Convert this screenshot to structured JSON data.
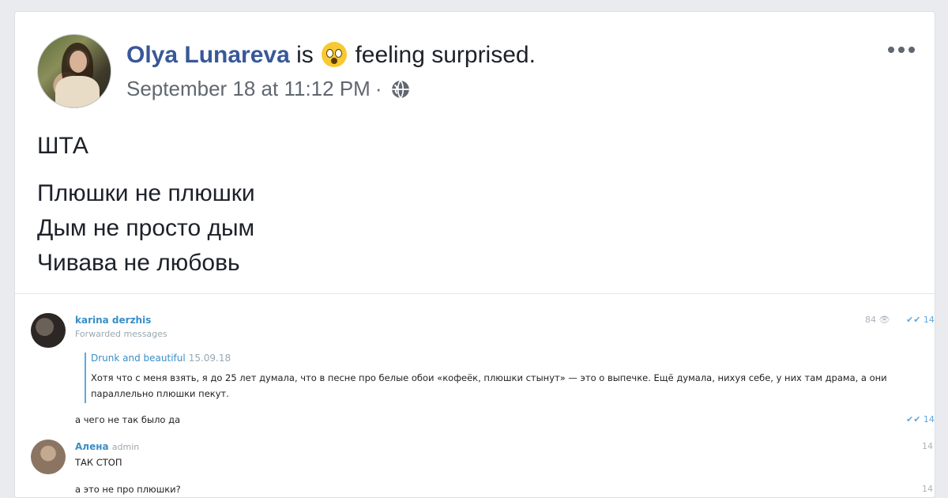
{
  "post": {
    "author": "Olya Lunareva",
    "is_text": "is",
    "feeling_text": "feeling surprised.",
    "timestamp": "September 18 at 11:12 PM",
    "separator": "·",
    "text_line_1": "ШТА",
    "text_line_2": "Плюшки не плюшки",
    "text_line_3": "Дым не просто дым",
    "text_line_4": "Чивава не любовь"
  },
  "chat": {
    "msg1": {
      "sender": "karina derzhis",
      "forwarded_label": "Forwarded messages",
      "views": "84 👁",
      "ticks": "✔✔ 14",
      "fwd_name": "Drunk and beautiful",
      "fwd_date": "15.09.18",
      "fwd_text": "Хотя что с меня взять, я до 25 лет думала, что в песне про белые обои «кофеёк, плюшки стынут» — это о выпечке. Ещё думала, нихуя себе, у них там драма, а они параллельно плюшки пекут.",
      "reply": "а чего не так было да",
      "reply_ticks": "✔✔ 14"
    },
    "msg2": {
      "sender": "Алена",
      "role": "admin",
      "text": "ТАК СТОП",
      "time": "14",
      "text2": "а это не про плюшки?",
      "time2": "14"
    }
  },
  "icons": {
    "feeling": "surprised-emoji-icon",
    "privacy": "globe-icon",
    "more": "more-options-icon"
  },
  "colors": {
    "author": "#385898",
    "meta": "#616770",
    "background": "#e9ebee"
  }
}
